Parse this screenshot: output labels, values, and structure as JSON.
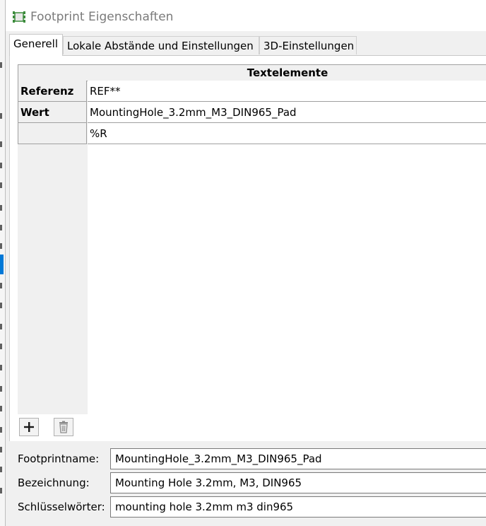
{
  "window": {
    "title": "Footprint Eigenschaften"
  },
  "tabs": [
    {
      "label": "Generell",
      "active": true
    },
    {
      "label": "Lokale Abstände und Einstellungen",
      "active": false
    },
    {
      "label": "3D-Einstellungen",
      "active": false
    }
  ],
  "text_items": {
    "column_header": "Textelemente",
    "rows": [
      {
        "label": "Referenz",
        "value": "REF**"
      },
      {
        "label": "Wert",
        "value": "MountingHole_3.2mm_M3_DIN965_Pad"
      },
      {
        "label": "",
        "value": "%R"
      }
    ]
  },
  "buttons": {
    "add_icon": "plus-icon",
    "delete_icon": "trash-icon"
  },
  "fields": {
    "footprint_name": {
      "label": "Footprintname:",
      "value": "MountingHole_3.2mm_M3_DIN965_Pad"
    },
    "description": {
      "label": "Bezeichnung:",
      "value": "Mounting Hole 3.2mm, M3, DIN965"
    },
    "keywords": {
      "label": "Schlüsselwörter:",
      "value": "mounting hole 3.2mm m3 din965"
    }
  },
  "colors": {
    "accent": "#0078d7",
    "grid_line": "#a0a0a0",
    "title_text": "#7a7a7a"
  }
}
